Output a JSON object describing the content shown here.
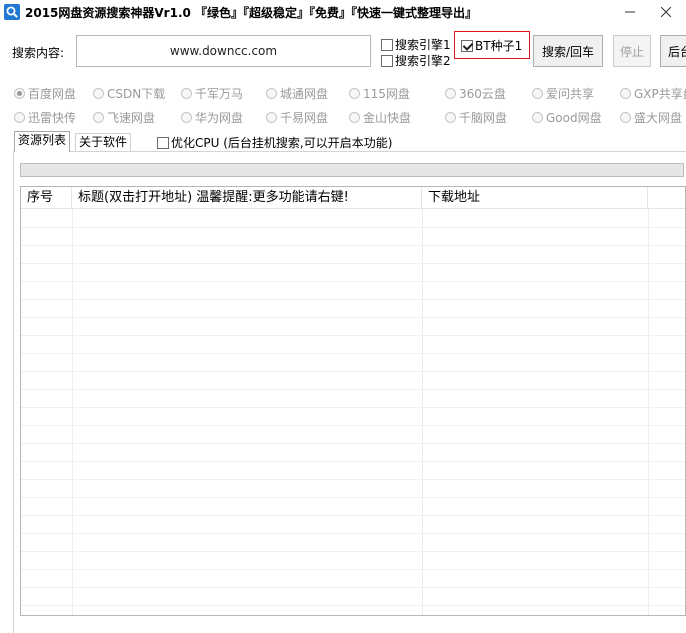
{
  "window": {
    "title": "2015网盘资源搜索神器Vr1.0 『绿色』『超级稳定』『免费』『快速一键式整理导出』",
    "app_icon": "magnifier-app-icon",
    "controls": [
      "minimize-icon",
      "close-icon"
    ]
  },
  "search": {
    "label": "搜索内容:",
    "value": "www.downcc.com",
    "engine1_label": "搜索引擎1",
    "engine1_checked": false,
    "engine2_label": "搜索引擎2",
    "engine2_checked": false,
    "bt_label": "BT种子1",
    "bt_checked": true,
    "bt_highlight_color": "#e0141b",
    "search_button": "搜索/回车",
    "stop_button": "停止",
    "background_button": "后台"
  },
  "sources": {
    "row1": [
      "百度网盘",
      "CSDN下载",
      "千军万马",
      "城通网盘",
      "115网盘",
      "360云盘",
      "爱问共享",
      "GXP共享盘"
    ],
    "row2": [
      "迅雷快传",
      "飞速网盘",
      "华为网盘",
      "千易网盘",
      "金山快盘",
      "千脑网盘",
      "Good网盘",
      "盛大网盘"
    ],
    "selected": "百度网盘",
    "disabled_color": "#9a9a9a"
  },
  "tabs": {
    "resource_list": "资源列表",
    "about": "关于软件",
    "active": "resource_list"
  },
  "optimize": {
    "label": "优化CPU (后台挂机搜索,可以开启本功能)",
    "checked": false
  },
  "progress": {
    "value": 0
  },
  "table": {
    "columns": {
      "index": "序号",
      "title": "标题(双击打开地址) 温馨提醒:更多功能请右键!",
      "download": "下载地址"
    },
    "rows": []
  }
}
